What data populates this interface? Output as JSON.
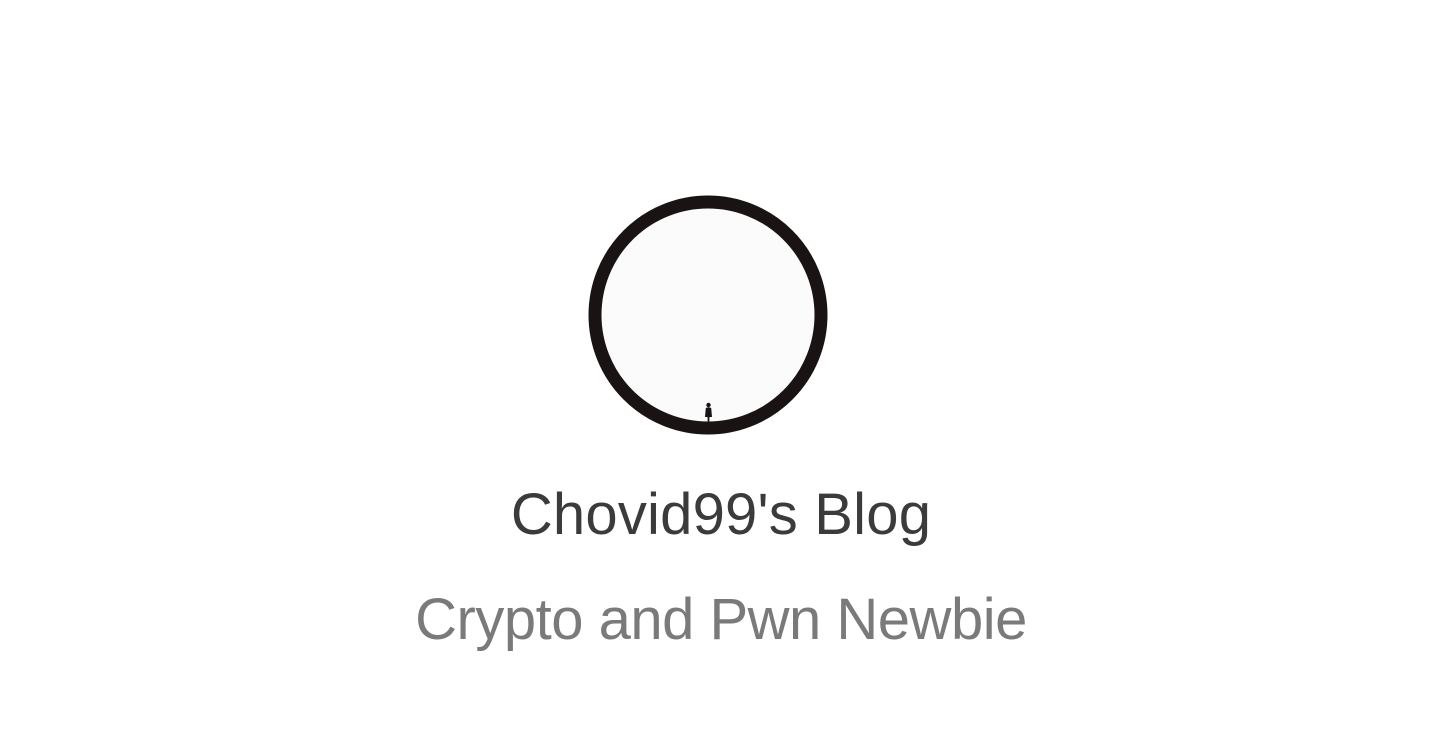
{
  "header": {
    "title": "Chovid99's Blog",
    "subtitle": "Crypto and Pwn Newbie"
  },
  "avatar": {
    "icon": "ring-with-figure-icon",
    "ring_color": "#1a1313",
    "fill_color": "#fbfbfb"
  },
  "colors": {
    "background": "#ffffff",
    "title": "#3b3b3b",
    "subtitle": "#7a7a7a"
  }
}
